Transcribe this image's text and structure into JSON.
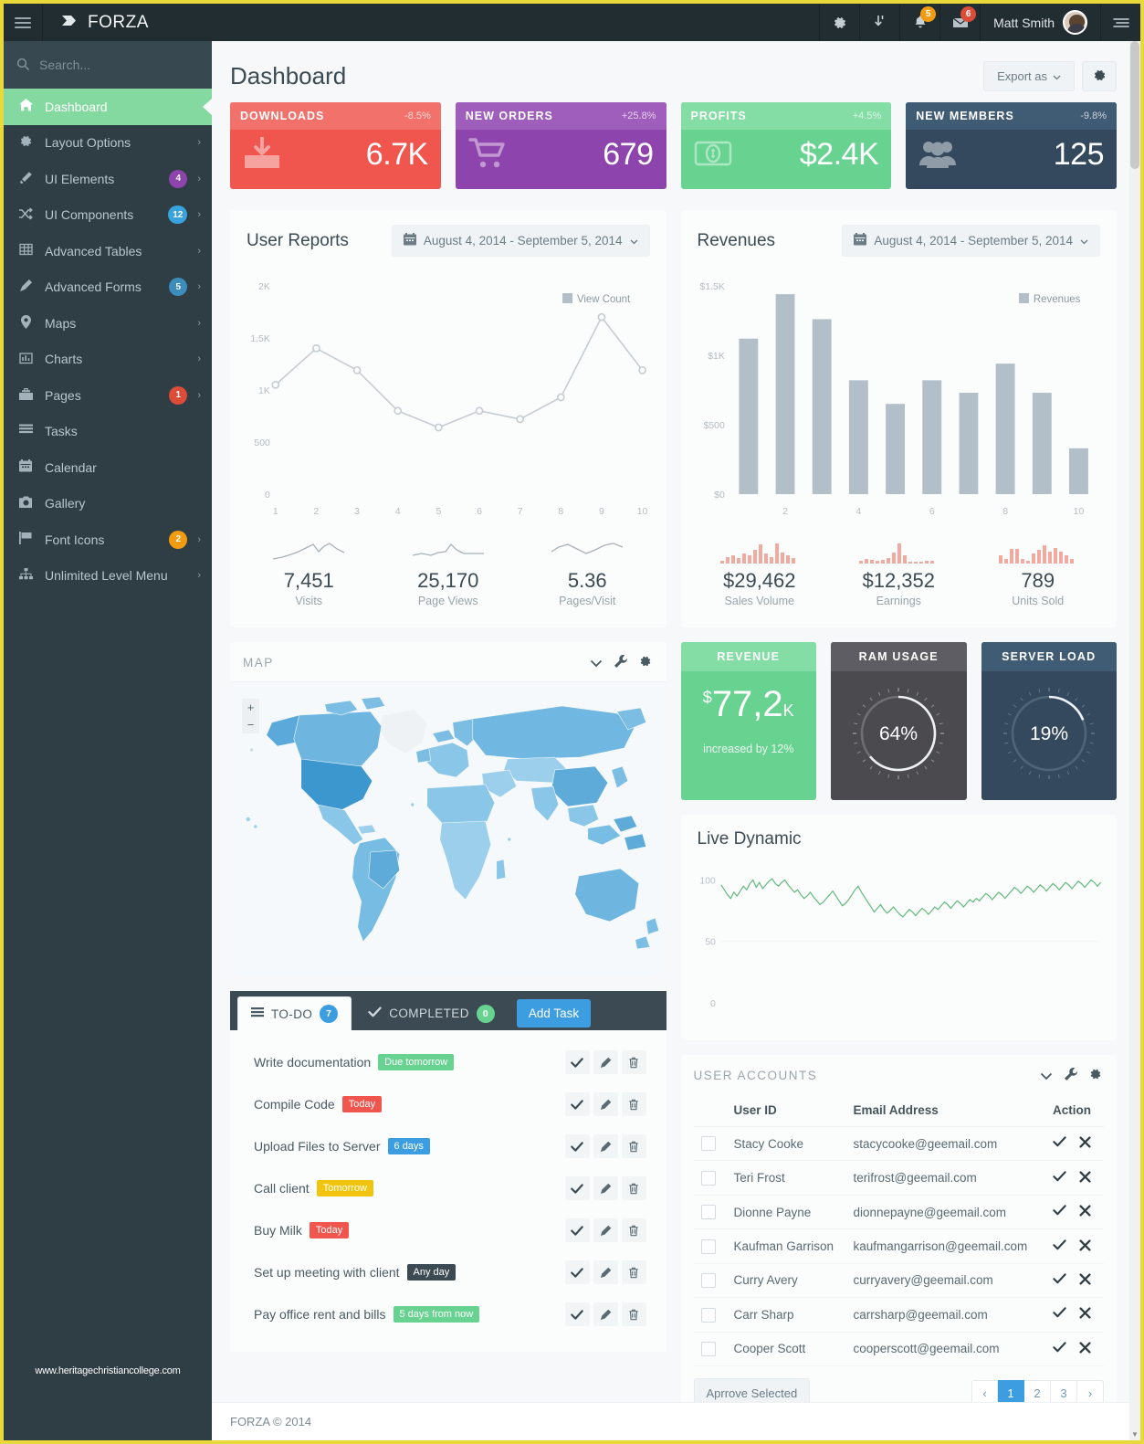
{
  "topnav": {
    "brand": "FORZA",
    "burger_name": "menu-toggle",
    "items": [
      {
        "name": "settings",
        "icon": "gear-icon",
        "badge": null
      },
      {
        "name": "downloads",
        "icon": "download-arrow-icon",
        "badge": null
      },
      {
        "name": "notifications",
        "icon": "bell-icon",
        "badge": "5",
        "badge_color": "#f39c12"
      },
      {
        "name": "messages",
        "icon": "envelope-icon",
        "badge": "6",
        "badge_color": "#dd4b39"
      }
    ],
    "user_name": "Matt Smith",
    "right_toggle_name": "control-sidebar-toggle"
  },
  "sidebar": {
    "search_placeholder": "Search...",
    "url": "www.heritagechristiancollege.com",
    "items": [
      {
        "label": "Dashboard",
        "icon": "home-icon",
        "active": true,
        "badge": null,
        "arrow": false
      },
      {
        "label": "Layout Options",
        "icon": "gear-icon",
        "active": false,
        "badge": null,
        "arrow": true
      },
      {
        "label": "UI Elements",
        "icon": "magic-wand-icon",
        "active": false,
        "badge": "4",
        "badge_class": "b-purple",
        "arrow": true
      },
      {
        "label": "UI Components",
        "icon": "shuffle-icon",
        "active": false,
        "badge": "12",
        "badge_class": "b-lightblue",
        "arrow": true
      },
      {
        "label": "Advanced Tables",
        "icon": "table-icon",
        "active": false,
        "badge": null,
        "arrow": true
      },
      {
        "label": "Advanced Forms",
        "icon": "pencil-icon",
        "active": false,
        "badge": "5",
        "badge_class": "b-blue",
        "arrow": true
      },
      {
        "label": "Maps",
        "icon": "map-pin-icon",
        "active": false,
        "badge": null,
        "arrow": true
      },
      {
        "label": "Charts",
        "icon": "bar-chart-icon",
        "active": false,
        "badge": null,
        "arrow": true
      },
      {
        "label": "Pages",
        "icon": "toolbox-icon",
        "active": false,
        "badge": "1",
        "badge_class": "b-red",
        "arrow": true
      },
      {
        "label": "Tasks",
        "icon": "list-icon",
        "active": false,
        "badge": null,
        "arrow": false
      },
      {
        "label": "Calendar",
        "icon": "calendar-icon",
        "active": false,
        "badge": null,
        "arrow": false
      },
      {
        "label": "Gallery",
        "icon": "camera-icon",
        "active": false,
        "badge": null,
        "arrow": false
      },
      {
        "label": "Font Icons",
        "icon": "flag-icon",
        "active": false,
        "badge": "2",
        "badge_class": "b-orange",
        "arrow": true
      },
      {
        "label": "Unlimited Level Menu",
        "icon": "sitemap-icon",
        "active": false,
        "badge": null,
        "arrow": true
      }
    ]
  },
  "page": {
    "title": "Dashboard",
    "export_label": "Export as",
    "settings_icon": "gear-icon"
  },
  "stats": [
    {
      "label": "DOWNLOADS",
      "pct": "-8.5%",
      "value": "6.7K",
      "icon": "download-tray-icon",
      "class": "sb-red",
      "color": "#f0554e"
    },
    {
      "label": "NEW ORDERS",
      "pct": "+25.8%",
      "value": "679",
      "icon": "shopping-cart-icon",
      "class": "sb-purple",
      "color": "#8e44ad"
    },
    {
      "label": "PROFITS",
      "pct": "+4.5%",
      "value": "$2.4K",
      "icon": "money-bill-icon",
      "class": "sb-green",
      "color": "#68d391"
    },
    {
      "label": "NEW MEMBERS",
      "pct": "-9.8%",
      "value": "125",
      "icon": "users-icon",
      "class": "sb-navy",
      "color": "#34495e"
    }
  ],
  "user_reports": {
    "title": "User Reports",
    "date_range": "August 4, 2014 - September 5, 2014",
    "calendar_icon": "calendar-icon",
    "sparks": [
      {
        "value": "7,451",
        "label": "Visits"
      },
      {
        "value": "25,170",
        "label": "Page Views"
      },
      {
        "value": "5.36",
        "label": "Pages/Visit"
      }
    ]
  },
  "revenues": {
    "title": "Revenues",
    "date_range": "August 4, 2014 - September 5, 2014",
    "calendar_icon": "calendar-icon",
    "sparks": [
      {
        "value": "$29,462",
        "label": "Sales Volume"
      },
      {
        "value": "$12,352",
        "label": "Earnings"
      },
      {
        "value": "789",
        "label": "Units Sold"
      }
    ]
  },
  "chart_data": [
    {
      "type": "line",
      "title": "User Reports",
      "legend": [
        "View Count"
      ],
      "legend_position": "top-right",
      "x": [
        1,
        2,
        3,
        4,
        5,
        6,
        7,
        8,
        9,
        10
      ],
      "xlabel": "",
      "ylabel": "",
      "ylim": [
        0,
        2000
      ],
      "yticks": [
        0,
        500,
        1000,
        1500,
        2000
      ],
      "ytick_labels": [
        "0",
        "500",
        "1K",
        "1.5K",
        "2K"
      ],
      "grid": false,
      "series": [
        {
          "name": "View Count",
          "color": "#c5cdd2",
          "values": [
            1050,
            1400,
            1190,
            800,
            640,
            800,
            720,
            930,
            1700,
            1190
          ]
        }
      ]
    },
    {
      "type": "bar",
      "title": "Revenues",
      "legend": [
        "Revenues"
      ],
      "legend_position": "top-right",
      "categories": [
        1,
        2,
        3,
        4,
        5,
        6,
        7,
        8,
        9,
        10
      ],
      "xtick_labels": [
        "",
        "2",
        "",
        "4",
        "",
        "6",
        "",
        "8",
        "",
        "10"
      ],
      "xlabel": "",
      "ylabel": "",
      "ylim": [
        0,
        1500
      ],
      "yticks": [
        0,
        500,
        1000,
        1500
      ],
      "ytick_labels": [
        "$0",
        "$500",
        "$1K",
        "$1.5K"
      ],
      "grid": false,
      "series": [
        {
          "name": "Revenues",
          "color": "#b2bfc8",
          "values": [
            1120,
            1440,
            1260,
            820,
            650,
            820,
            730,
            940,
            730,
            330
          ]
        }
      ]
    },
    {
      "type": "line",
      "title": "Live Dynamic",
      "xlabel": "",
      "ylabel": "",
      "ylim": [
        0,
        110
      ],
      "yticks": [
        0,
        50,
        100
      ],
      "ytick_labels": [
        "0",
        "50",
        "100"
      ],
      "grid": false,
      "series": [
        {
          "name": "live",
          "color": "#62b97c",
          "values": [
            96,
            92,
            88,
            85,
            90,
            87,
            91,
            95,
            92,
            97,
            100,
            94,
            98,
            93,
            96,
            99,
            101,
            97,
            95,
            98,
            100,
            96,
            93,
            90,
            92,
            88,
            85,
            87,
            90,
            86,
            83,
            80,
            82,
            85,
            88,
            91,
            87,
            83,
            79,
            81,
            84,
            88,
            92,
            95,
            90,
            86,
            82,
            78,
            74,
            77,
            80,
            76,
            73,
            75,
            78,
            75,
            72,
            70,
            73,
            76,
            74,
            71,
            74,
            77,
            75,
            72,
            75,
            78,
            76,
            79,
            82,
            80,
            77,
            80,
            83,
            81,
            78,
            81,
            84,
            82,
            85,
            83,
            86,
            89,
            87,
            84,
            87,
            90,
            88,
            85,
            88,
            91,
            94,
            92,
            89,
            92,
            95,
            93,
            90,
            93,
            96,
            94,
            91,
            94,
            97,
            95,
            92,
            95,
            98,
            96,
            93,
            96,
            99,
            97,
            94,
            97,
            100,
            98,
            95,
            98
          ]
        }
      ]
    }
  ],
  "map_box": {
    "title": "MAP",
    "collapse_icon": "chevron-down-icon",
    "wrench_icon": "wrench-icon",
    "gear_icon": "gear-icon",
    "zoom_in": "+",
    "zoom_out": "−"
  },
  "mini_boxes": [
    {
      "title": "REVENUE",
      "type": "amount",
      "currency": "$",
      "value": "77,2",
      "unit": "K",
      "sub": "increased by 12%",
      "class": "mb-green"
    },
    {
      "title": "RAM USAGE",
      "type": "gauge",
      "value": "64%",
      "percent": 64,
      "class": "mb-gray"
    },
    {
      "title": "SERVER LOAD",
      "type": "gauge",
      "value": "19%",
      "percent": 19,
      "class": "mb-navy"
    }
  ],
  "live_dynamic": {
    "title": "Live Dynamic"
  },
  "todo": {
    "tabs": [
      {
        "label": "TO-DO",
        "count": "7",
        "icon": "list-icon",
        "active": true,
        "badge_class": "t-blue"
      },
      {
        "label": "COMPLETED",
        "count": "0",
        "icon": "check-icon",
        "active": false,
        "badge_class": "t-green"
      }
    ],
    "add_label": "Add Task",
    "items": [
      {
        "text": "Write documentation",
        "tag": "Due tomorrow",
        "tag_class": "tg-green"
      },
      {
        "text": "Compile Code",
        "tag": "Today",
        "tag_class": "tg-red"
      },
      {
        "text": "Upload Files to Server",
        "tag": "6 days",
        "tag_class": "tg-blue"
      },
      {
        "text": "Call client",
        "tag": "Tomorrow",
        "tag_class": "tg-yellow"
      },
      {
        "text": "Buy Milk",
        "tag": "Today",
        "tag_class": "tg-red"
      },
      {
        "text": "Set up meeting with client",
        "tag": "Any day",
        "tag_class": "tg-dark"
      },
      {
        "text": "Pay office rent and bills",
        "tag": "5 days from now",
        "tag_class": "tg-green"
      }
    ],
    "action_icons": [
      "check-icon",
      "pencil-icon",
      "trash-icon"
    ]
  },
  "user_accounts": {
    "title": "USER ACCOUNTS",
    "collapse_icon": "chevron-down-icon",
    "wrench_icon": "wrench-icon",
    "gear_icon": "gear-icon",
    "columns": [
      "",
      "User ID",
      "Email Address",
      "Action"
    ],
    "rows": [
      {
        "user": "Stacy Cooke",
        "email": "stacycooke@geemail.com"
      },
      {
        "user": "Teri Frost",
        "email": "terifrost@geemail.com"
      },
      {
        "user": "Dionne Payne",
        "email": "dionnepayne@geemail.com"
      },
      {
        "user": "Kaufman Garrison",
        "email": "kaufmangarrison@geemail.com"
      },
      {
        "user": "Curry Avery",
        "email": "curryavery@geemail.com"
      },
      {
        "user": "Carr Sharp",
        "email": "carrsharp@geemail.com"
      },
      {
        "user": "Cooper Scott",
        "email": "cooperscott@geemail.com"
      }
    ],
    "approve_label": "Aprrove Selected",
    "pagination": {
      "prev": "‹",
      "pages": [
        "1",
        "2",
        "3"
      ],
      "active": "1",
      "next": "›"
    }
  },
  "footer": {
    "text": "FORZA © 2014"
  }
}
